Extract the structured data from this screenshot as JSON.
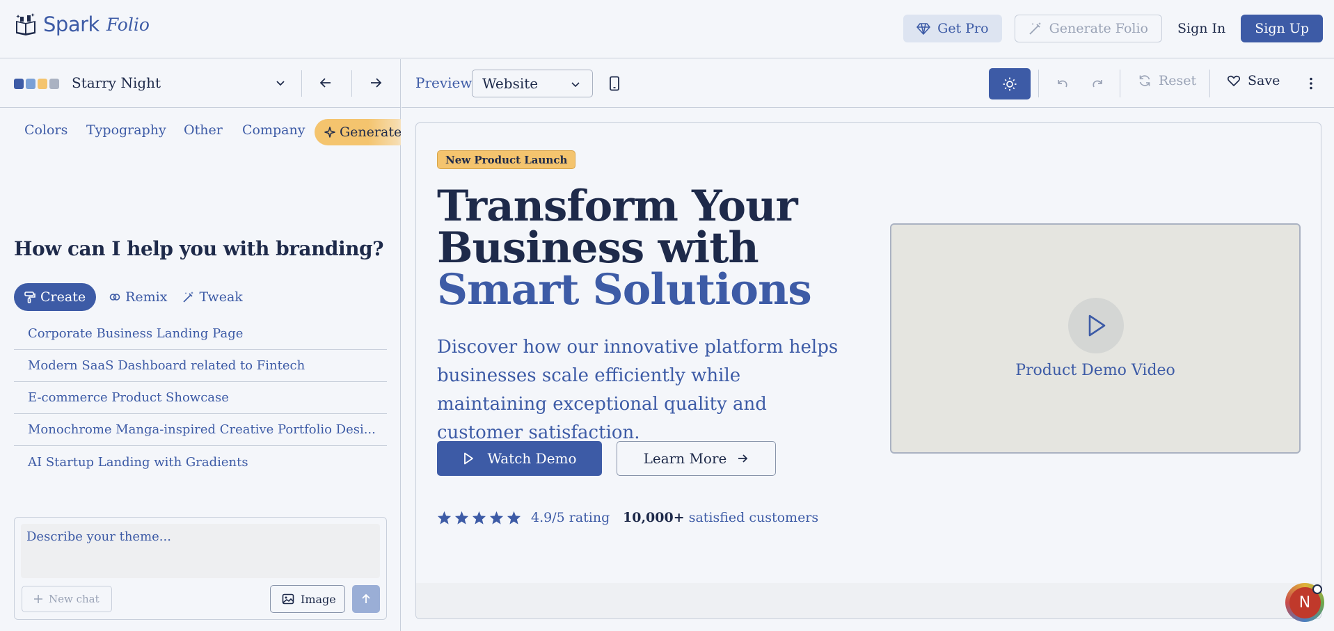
{
  "app": {
    "logo_word": "Spark",
    "logo_word_italic": "Folio"
  },
  "topbar": {
    "get_pro": "Get Pro",
    "generate_folio": "Generate Folio",
    "sign_in": "Sign In",
    "sign_up": "Sign Up"
  },
  "theme": {
    "name": "Starry Night",
    "swatches": [
      "#3d5ba6",
      "#7aa0d6",
      "#f4c46e",
      "#aab2c2"
    ]
  },
  "tabs": [
    {
      "label": "Colors"
    },
    {
      "label": "Typography"
    },
    {
      "label": "Other"
    },
    {
      "label": "Company"
    }
  ],
  "generate_tab": "Generate",
  "assistant": {
    "heading": "How can I help you with branding?",
    "modes": [
      {
        "label": "Create",
        "active": true
      },
      {
        "label": "Remix",
        "active": false
      },
      {
        "label": "Tweak",
        "active": false
      }
    ],
    "suggestions": [
      "Corporate Business Landing Page",
      "Modern SaaS Dashboard related to Fintech",
      "E-commerce Product Showcase",
      "Monochrome Manga-inspired Creative Portfolio Desi...",
      "AI Startup Landing with Gradients"
    ],
    "input_placeholder": "Describe your theme...",
    "new_chat": "New chat",
    "image": "Image"
  },
  "toolbar": {
    "preview_label": "Preview",
    "preview_mode": "Website",
    "reset": "Reset",
    "save": "Save"
  },
  "preview": {
    "badge": "New Product Launch",
    "title_line1": "Transform Your",
    "title_line2": "Business with",
    "title_accent": "Smart Solutions",
    "description": "Discover how our innovative platform helps businesses scale efficiently while maintaining exceptional quality and customer satisfaction.",
    "cta_primary": "Watch Demo",
    "cta_secondary": "Learn More",
    "stars": 5,
    "rating_text": "4.9/5 rating",
    "customers_count": "10,000+",
    "customers_text": "satisfied customers",
    "video_label": "Product Demo Video"
  },
  "user": {
    "avatar_initial": "N"
  },
  "colors": {
    "brand": "#3d5ba6",
    "accent": "#f4c46e",
    "text": "#1e2a4a"
  }
}
